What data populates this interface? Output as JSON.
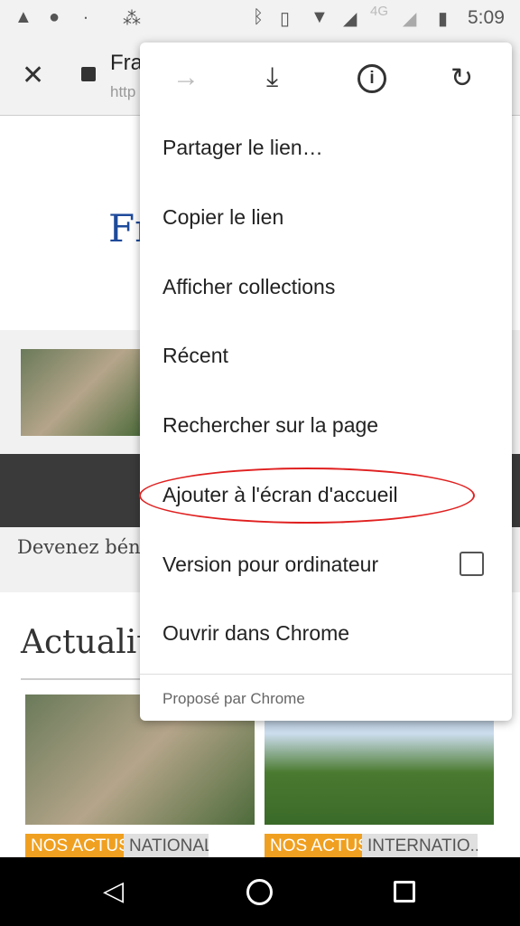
{
  "status_bar": {
    "time": "5:09",
    "network": "4G"
  },
  "toolbar": {
    "title": "Fra",
    "url": "http"
  },
  "page": {
    "logo_text": "Fr",
    "banner_text": "Devenez bén",
    "section_title": "Actualit",
    "cards": [
      {
        "tag1": "NOS ACTUS",
        "tag2": "NATIONAL"
      },
      {
        "tag1": "NOS ACTUS",
        "tag2": "INTERNATIO..."
      }
    ]
  },
  "menu": {
    "items": [
      "Partager le lien…",
      "Copier le lien",
      "Afficher collections",
      "Récent",
      "Rechercher sur la page",
      "Ajouter à l'écran d'accueil",
      "Version pour ordinateur",
      "Ouvrir dans Chrome"
    ],
    "desktop_checked": false,
    "footer": "Proposé par Chrome",
    "highlight_color": "#e02020"
  }
}
